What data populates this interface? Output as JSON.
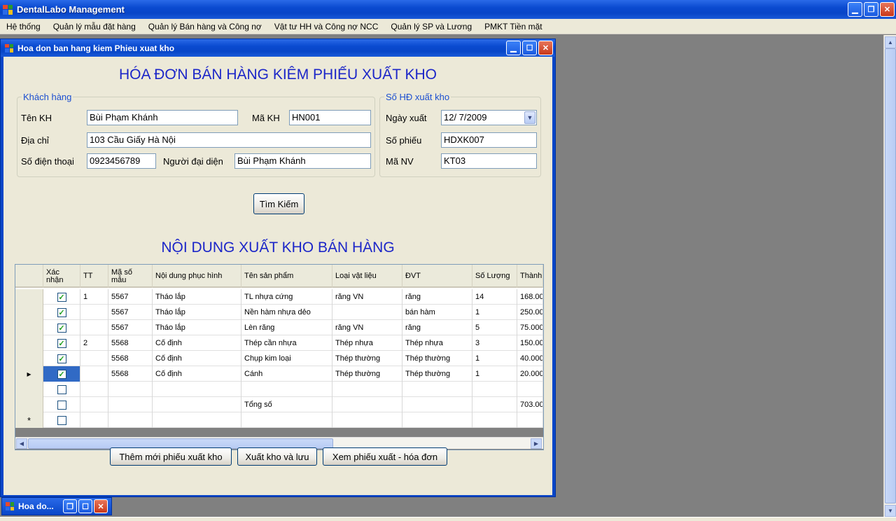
{
  "app": {
    "title": "DentalLabo Management"
  },
  "menu": [
    "Hệ thống",
    "Quản lý mẫu đặt hàng",
    "Quản lý Bán hàng và Công nợ",
    "Vật tư HH và Công nợ NCC",
    "Quản lý SP và Lương",
    "PMKT Tiền mặt"
  ],
  "child_window": {
    "title": "Hoa don ban hang kiem Phieu xuat kho",
    "minimized_title": "Hoa do..."
  },
  "form": {
    "title": "HÓA ĐƠN BÁN HÀNG KIÊM PHIẾU XUẤT KHO",
    "customer_group": {
      "legend": "Khách hàng",
      "name_label": "Tên KH",
      "name_value": "Bùi Phạm Khánh",
      "code_label": "Mã KH",
      "code_value": "HN001",
      "address_label": "Địa chỉ",
      "address_value": "103 Cầu Giấy Hà Nội",
      "phone_label": "Số điện thoại",
      "phone_value": "0923456789",
      "rep_label": "Người đại diện",
      "rep_value": "Bùi Phạm Khánh"
    },
    "invoice_group": {
      "legend": "Số HĐ xuất kho",
      "date_label": "Ngày xuất",
      "date_value": "12/  7/2009",
      "number_label": "Số phiếu",
      "number_value": "HDXK007",
      "staff_label": "Mã NV",
      "staff_value": "KT03"
    },
    "search_button": "Tìm Kiếm",
    "section_title": "NỘI DUNG XUẤT KHO BÁN HÀNG"
  },
  "grid": {
    "columns": [
      "Xác nhận",
      "TT",
      "Mã số mẫu",
      "Nội dung phục hình",
      "Tên sản phẩm",
      "Loại vật liệu",
      "ĐVT",
      "Số Lượng",
      "Thành"
    ],
    "rows": [
      {
        "checked": true,
        "tt": "1",
        "ma": "5567",
        "noidung": "Tháo lắp",
        "ten": "TL nhựa cứng",
        "loai": "răng VN",
        "dvt": "răng",
        "sl": "14",
        "thanh": "168.00"
      },
      {
        "checked": true,
        "tt": "",
        "ma": "5567",
        "noidung": "Tháo lắp",
        "ten": "Nền hàm nhựa dẻo",
        "loai": "",
        "dvt": "bán hàm",
        "sl": "1",
        "thanh": "250.00"
      },
      {
        "checked": true,
        "tt": "",
        "ma": "5567",
        "noidung": "Tháo lắp",
        "ten": "Lèn răng",
        "loai": "răng VN",
        "dvt": "răng",
        "sl": "5",
        "thanh": "75.000"
      },
      {
        "checked": true,
        "tt": "2",
        "ma": "5568",
        "noidung": "Cố định",
        "ten": "Thép cần nhựa",
        "loai": "Thép nhựa",
        "dvt": "Thép nhựa",
        "sl": "3",
        "thanh": "150.00"
      },
      {
        "checked": true,
        "tt": "",
        "ma": "5568",
        "noidung": "Cố định",
        "ten": "Chụp kim loại",
        "loai": "Thép thường",
        "dvt": "Thép thường",
        "sl": "1",
        "thanh": "40.000"
      },
      {
        "checked": true,
        "tt": "",
        "ma": "5568",
        "noidung": "Cố định",
        "ten": "Cánh",
        "loai": "Thép thường",
        "dvt": "Thép thường",
        "sl": "1",
        "thanh": "20.000",
        "current": true
      },
      {
        "checked": false,
        "tt": "",
        "ma": "",
        "noidung": "",
        "ten": "",
        "loai": "",
        "dvt": "",
        "sl": "",
        "thanh": ""
      },
      {
        "checked": false,
        "tt": "",
        "ma": "",
        "noidung": "",
        "ten": "Tổng số",
        "loai": "",
        "dvt": "",
        "sl": "",
        "thanh": "703.00"
      },
      {
        "checked": false,
        "tt": "",
        "ma": "",
        "noidung": "",
        "ten": "",
        "loai": "",
        "dvt": "",
        "sl": "",
        "thanh": "",
        "newrow": true
      }
    ]
  },
  "buttons": {
    "add": "Thêm mới phiếu xuất kho",
    "export": "Xuất kho và lưu",
    "view": "Xem phiếu xuất - hóa đơn"
  },
  "icons": {
    "current_row": "▸",
    "new_row": "*",
    "check": "✓"
  }
}
